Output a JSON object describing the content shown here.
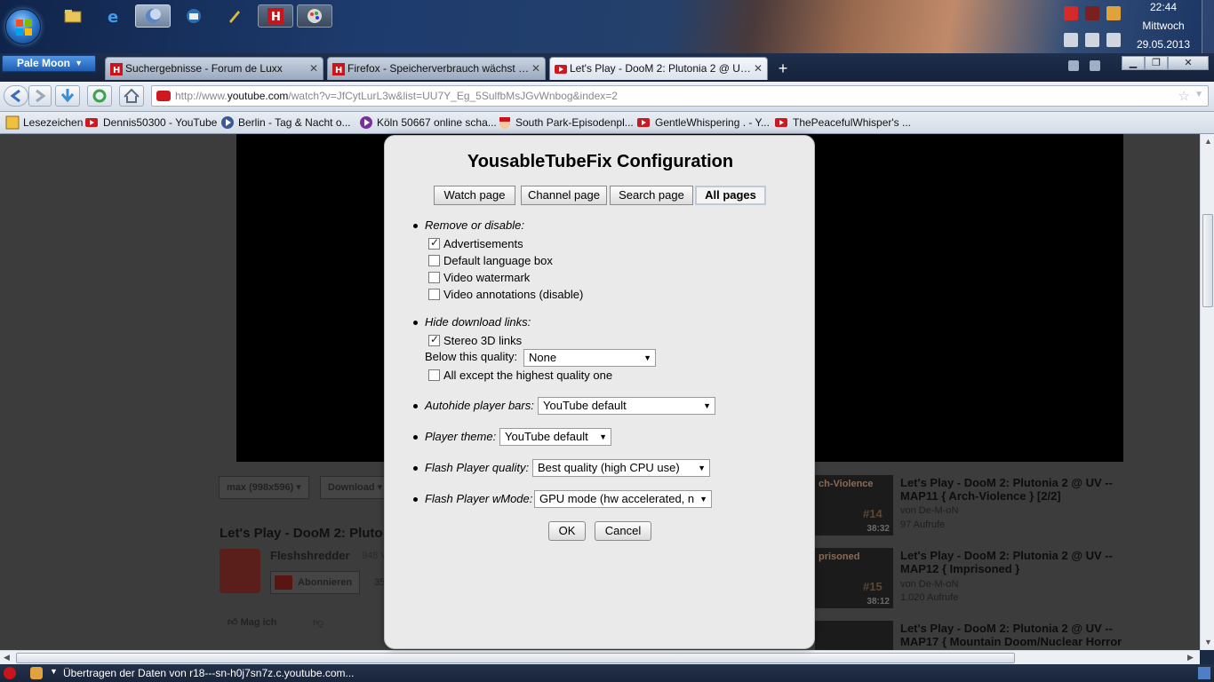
{
  "taskbar": {
    "clock_time": "22:44",
    "clock_day": "Mittwoch",
    "clock_date": "29.05.2013"
  },
  "browser": {
    "app_button": "Pale Moon",
    "tabs": [
      {
        "label": "Suchergebnisse - Forum de Luxx"
      },
      {
        "label": "Firefox - Speicherverbrauch wächst u..."
      },
      {
        "label": "Let's Play - DooM 2: Plutonia 2 @ UV ..."
      }
    ],
    "new_tab": "+",
    "url_prefix": "http://www.",
    "url_domain": "youtube.com",
    "url_rest": "/watch?v=JfCytLurL3w&list=UU7Y_Eg_5SulfbMsJGvWnbog&index=2",
    "bookmarks": [
      {
        "label": "Lesezeichen"
      },
      {
        "label": "Dennis50300 - YouTube"
      },
      {
        "label": "Berlin - Tag & Nacht o..."
      },
      {
        "label": "Köln 50667 online scha..."
      },
      {
        "label": "South Park-Episodenpl..."
      },
      {
        "label": "GentleWhispering . - Y..."
      },
      {
        "label": "ThePeacefulWhisper's ..."
      }
    ],
    "status": "Übertragen der Daten von r18---sn-h0j7sn7z.c.youtube.com..."
  },
  "page": {
    "quality_button": "max (998x596)",
    "download_button": "Download",
    "video_title": "Let's Play - DooM 2: Pluto",
    "channel": "Fleshshredder",
    "channel_count": "948 V",
    "subscribe": "Abonnieren",
    "subscribe_count": "35",
    "like": "Mag ich",
    "related": [
      {
        "title": "Let's Play - DooM 2: Plutonia 2 @ UV -- MAP11 { Arch-Violence } [2/2]",
        "author": "von De-M-oN",
        "views": "97 Aufrufe",
        "duration": "38:32",
        "thumb_text": "ch-Violence",
        "num": "#14"
      },
      {
        "title": "Let's Play - DooM 2: Plutonia 2 @ UV -- MAP12 { Imprisoned }",
        "author": "von De-M-oN",
        "views": "1.020 Aufrufe",
        "duration": "38:12",
        "thumb_text": "prisoned",
        "num": "#15"
      },
      {
        "title": "Let's Play - DooM 2: Plutonia 2 @ UV -- MAP17 { Mountain Doom/Nuclear Horror",
        "author": "",
        "views": "",
        "duration": "",
        "thumb_text": "",
        "num": ""
      }
    ]
  },
  "dialog": {
    "title": "YousableTubeFix Configuration",
    "tabs": [
      "Watch page",
      "Channel page",
      "Search page",
      "All pages"
    ],
    "active_tab": "All pages",
    "remove_section": "Remove or disable:",
    "remove_options": [
      {
        "label": "Advertisements",
        "checked": true
      },
      {
        "label": "Default language box",
        "checked": false
      },
      {
        "label": "Video watermark",
        "checked": false
      },
      {
        "label": "Video annotations (disable)",
        "checked": false
      }
    ],
    "hide_section": "Hide download links:",
    "stereo_label": "Stereo 3D links",
    "stereo_checked": true,
    "below_quality_label": "Below this quality:",
    "below_quality_value": "None",
    "all_except_label": "All except the highest quality one",
    "all_except_checked": false,
    "autohide_label": "Autohide player bars:",
    "autohide_value": "YouTube default",
    "theme_label": "Player theme:",
    "theme_value": "YouTube default",
    "flash_quality_label": "Flash Player quality:",
    "flash_quality_value": "Best quality (high CPU use)",
    "wmode_label": "Flash Player wMode:",
    "wmode_value": "GPU mode (hw accelerated, n",
    "ok": "OK",
    "cancel": "Cancel"
  }
}
